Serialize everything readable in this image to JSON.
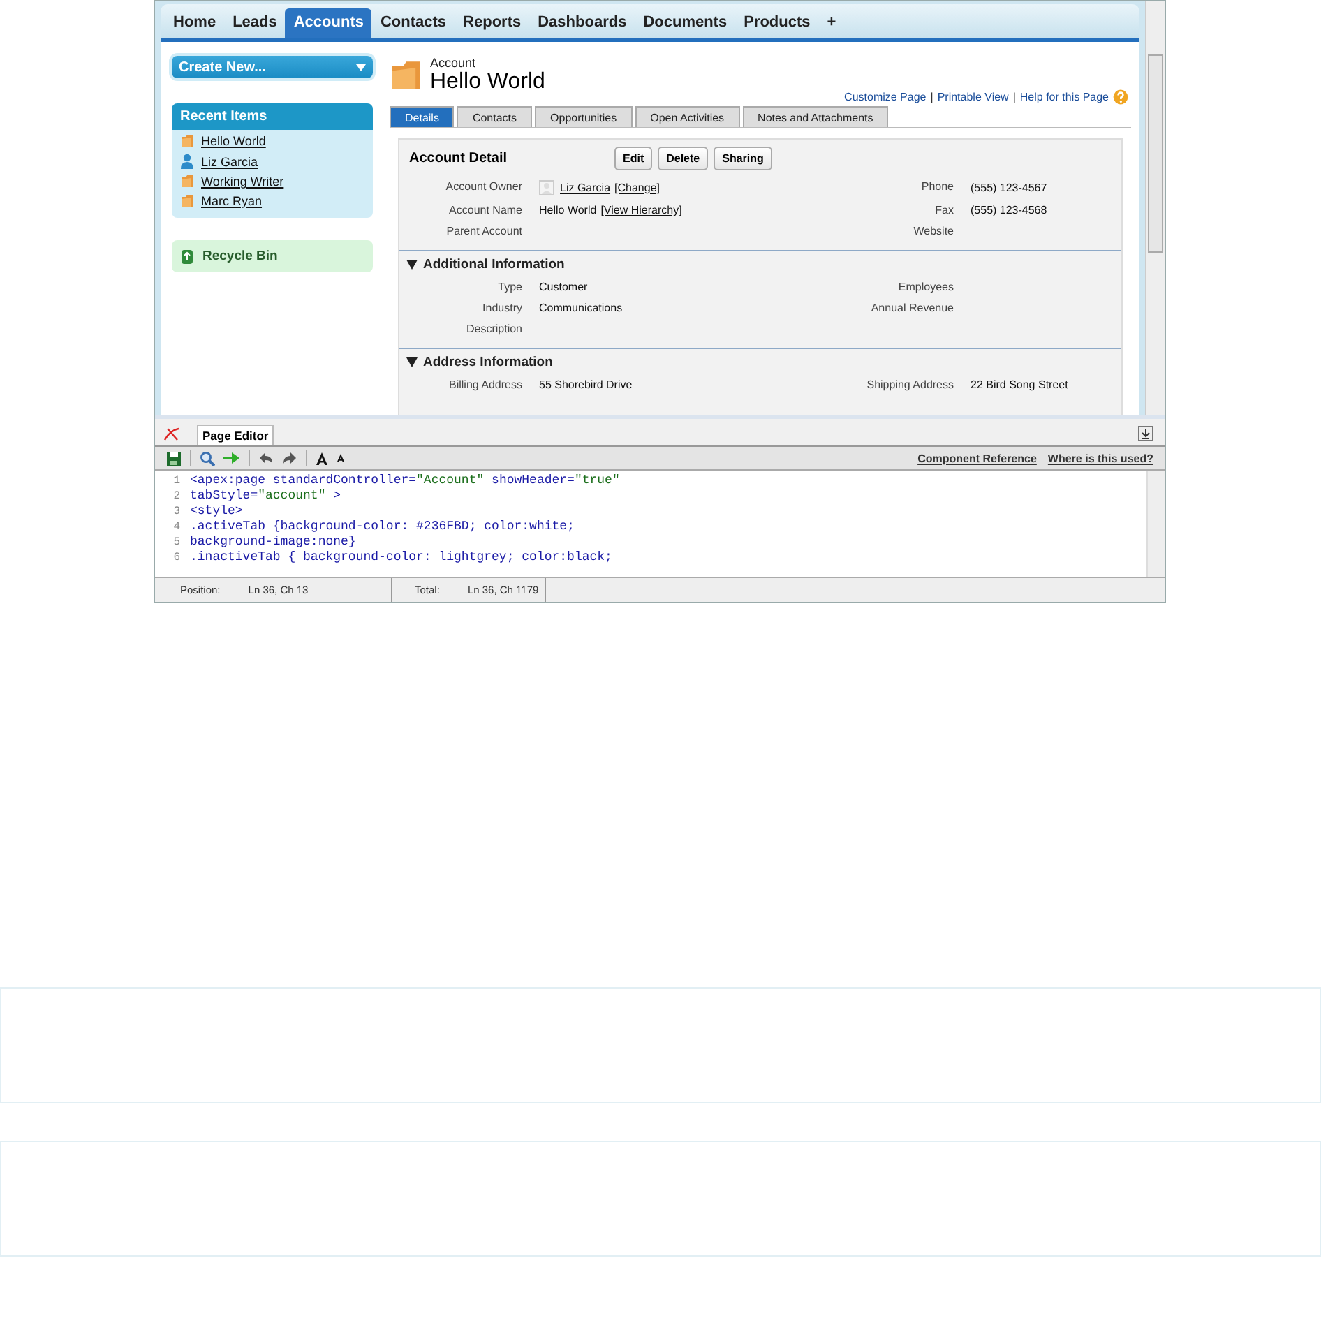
{
  "nav_tabs": [
    {
      "label": "Home",
      "selected": false
    },
    {
      "label": "Leads",
      "selected": false
    },
    {
      "label": "Accounts",
      "selected": true
    },
    {
      "label": "Contacts",
      "selected": false
    },
    {
      "label": "Reports",
      "selected": false
    },
    {
      "label": "Dashboards",
      "selected": false
    },
    {
      "label": "Documents",
      "selected": false
    },
    {
      "label": "Products",
      "selected": false
    },
    {
      "label": "+",
      "selected": false
    }
  ],
  "sidebar": {
    "create_button": "Create New...",
    "recent_title": "Recent Items",
    "recent_items": [
      {
        "label": "Hello World",
        "kind": "account"
      },
      {
        "label": "Liz Garcia",
        "kind": "contact"
      },
      {
        "label": "Working Writer",
        "kind": "account"
      },
      {
        "label": "Marc Ryan",
        "kind": "account"
      }
    ],
    "recycle_bin": "Recycle Bin"
  },
  "record": {
    "type": "Account",
    "name": "Hello World",
    "links": [
      "Customize Page",
      "Printable View",
      "Help for this Page"
    ],
    "link_separator": "|",
    "tabs": [
      {
        "label": "Details",
        "selected": true
      },
      {
        "label": "Contacts",
        "selected": false
      },
      {
        "label": "Opportunities",
        "selected": false
      },
      {
        "label": "Open Activities",
        "selected": false
      },
      {
        "label": "Notes and Attachments",
        "selected": false
      }
    ],
    "detail_title": "Account Detail",
    "buttons": [
      "Edit",
      "Delete",
      "Sharing"
    ],
    "rows": [
      [
        {
          "label": "Account Owner",
          "avatar": true,
          "links": [
            "Liz Garcia",
            "[Change]"
          ]
        },
        {
          "label": "Phone",
          "value": "(555) 123-4567"
        }
      ],
      [
        {
          "label": "Account Name",
          "value": "Hello World",
          "links": [
            "[View Hierarchy]"
          ]
        },
        {
          "label": "Fax",
          "value": "(555) 123-4568"
        }
      ],
      [
        {
          "label": "Parent Account"
        },
        {
          "label": "Website"
        }
      ]
    ],
    "sections": [
      {
        "title": "Additional Information",
        "expanded": true,
        "rows": [
          [
            {
              "label": "Type",
              "value": "Customer"
            },
            {
              "label": "Employees"
            }
          ],
          [
            {
              "label": "Industry",
              "value": "Communications"
            },
            {
              "label": "Annual Revenue"
            }
          ],
          [
            {
              "label": "Description"
            }
          ]
        ]
      },
      {
        "title": "Address Information",
        "expanded": true,
        "rows": [
          [
            {
              "label": "Billing Address",
              "value": "55 Shorebird Drive"
            },
            {
              "label": "Shipping Address",
              "value": "22 Bird Song Street"
            }
          ]
        ]
      }
    ]
  },
  "editor": {
    "tab": "Page Editor",
    "links": [
      "Component Reference",
      "Where is this used?"
    ],
    "lines": [
      {
        "number": "1",
        "text": "<apex:page standardController=\"Account\" showHeader=\"true\""
      },
      {
        "number": "2",
        "text": "tabStyle=\"account\" >"
      },
      {
        "number": "3",
        "text": "<style>"
      },
      {
        "number": "4",
        "text": ".activeTab {background-color: #236FBD; color:white;"
      },
      {
        "number": "5",
        "text": "background-image:none}"
      },
      {
        "number": "6",
        "text": ".inactiveTab { background-color: lightgrey; color:black;"
      }
    ],
    "status": [
      {
        "label": "Position:",
        "value": "Ln 36, Ch 13"
      },
      {
        "label": "Total:",
        "value": "Ln 36, Ch 1179"
      }
    ]
  }
}
